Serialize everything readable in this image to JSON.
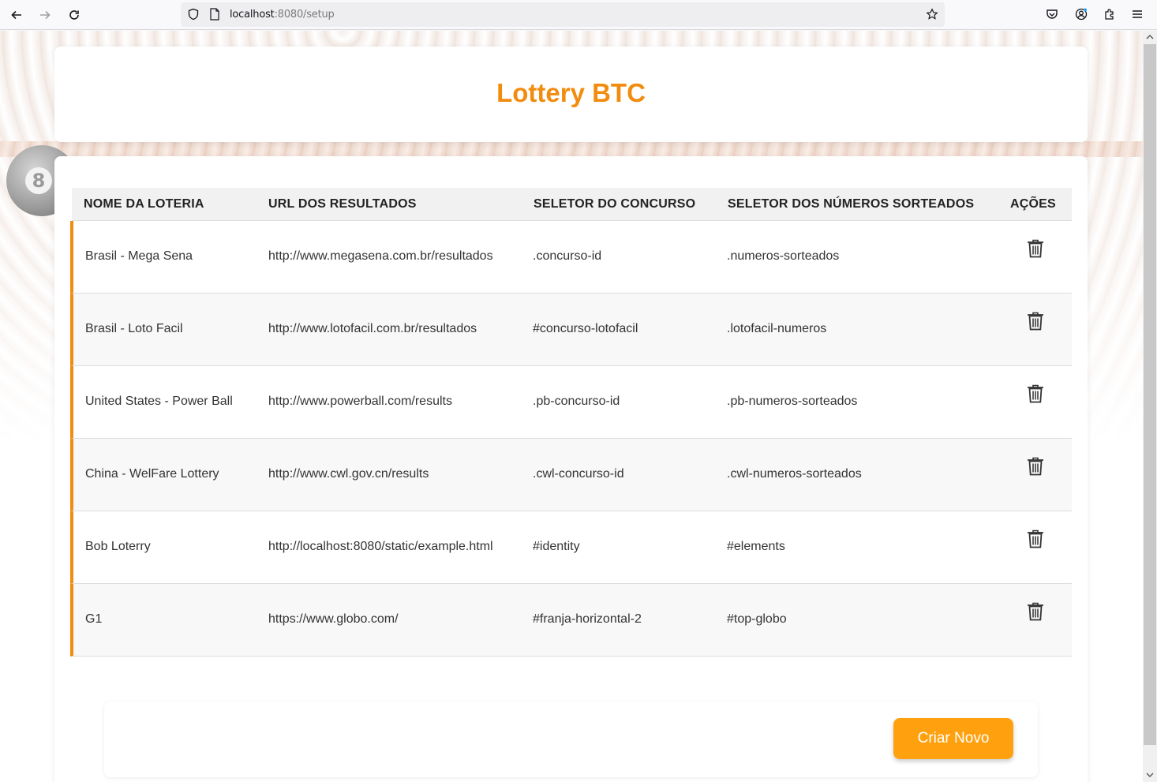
{
  "browser": {
    "url_host": "localhost",
    "url_path": ":8080/setup"
  },
  "page": {
    "title": "Lottery BTC"
  },
  "table": {
    "headers": [
      "NOME DA LOTERIA",
      "URL DOS RESULTADOS",
      "SELETOR DO CONCURSO",
      "SELETOR DOS NÚMEROS SORTEADOS",
      "AÇÕES"
    ],
    "rows": [
      {
        "name": "Brasil - Mega Sena",
        "url": "http://www.megasena.com.br/resultados",
        "contest_selector": ".concurso-id",
        "numbers_selector": ".numeros-sorteados"
      },
      {
        "name": "Brasil - Loto Facil",
        "url": "http://www.lotofacil.com.br/resultados",
        "contest_selector": "#concurso-lotofacil",
        "numbers_selector": ".lotofacil-numeros"
      },
      {
        "name": "United States - Power Ball",
        "url": "http://www.powerball.com/results",
        "contest_selector": ".pb-concurso-id",
        "numbers_selector": ".pb-numeros-sorteados"
      },
      {
        "name": "China - WelFare Lottery",
        "url": "http://www.cwl.gov.cn/results",
        "contest_selector": ".cwl-concurso-id",
        "numbers_selector": ".cwl-numeros-sorteados"
      },
      {
        "name": "Bob Loterry",
        "url": "http://localhost:8080/static/example.html",
        "contest_selector": "#identity",
        "numbers_selector": "#elements"
      },
      {
        "name": "G1",
        "url": "https://www.globo.com/",
        "contest_selector": "#franja-horizontal-2",
        "numbers_selector": "#top-globo"
      }
    ]
  },
  "actions": {
    "create_new": "Criar Novo"
  },
  "decor": {
    "ball_number": "8"
  },
  "colors": {
    "accent": "#f28c0f",
    "button": "#ffa10f"
  }
}
